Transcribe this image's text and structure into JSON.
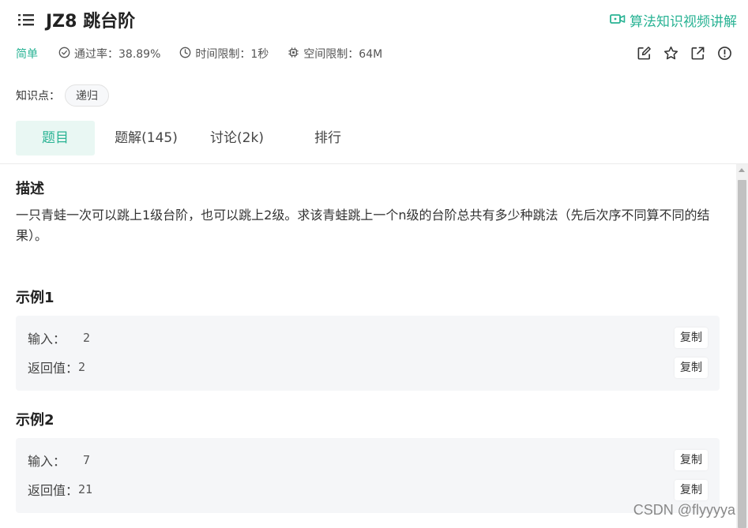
{
  "header": {
    "menu_icon": "list-icon",
    "title": "JZ8  跳台阶",
    "video_link": "算法知识视频讲解",
    "video_icon": "video-icon",
    "accent_color": "#29b394"
  },
  "meta": {
    "difficulty": "简单",
    "pass_rate": "通过率：38.89%",
    "time_limit": "时间限制：1秒",
    "memory_limit": "空间限制：64M"
  },
  "actions": [
    "edit-icon",
    "star-icon",
    "share-icon",
    "report-icon"
  ],
  "knowledge": {
    "label": "知识点：",
    "tag": "递归"
  },
  "tabs": [
    {
      "label": "题目",
      "active": true
    },
    {
      "label": "题解(145)"
    },
    {
      "label": "讨论(2k)"
    },
    {
      "label": "排行"
    }
  ],
  "description": {
    "title": "描述",
    "text": "一只青蛙一次可以跳上1级台阶，也可以跳上2级。求该青蛙跳上一个n级的台阶总共有多少种跳法（先后次序不同算不同的结果）。"
  },
  "examples": [
    {
      "title": "示例1",
      "input_label": "输入：",
      "input_value": "2",
      "output_label": "返回值：",
      "output_value": "2",
      "copy_label": "复制"
    },
    {
      "title": "示例2",
      "input_label": "输入：",
      "input_value": "7",
      "output_label": "返回值：",
      "output_value": "21",
      "copy_label": "复制"
    }
  ],
  "watermark": "CSDN @flyyyya"
}
